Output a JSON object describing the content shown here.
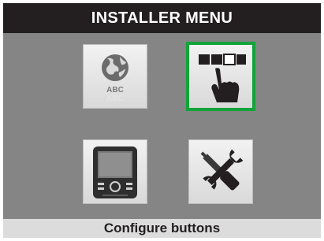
{
  "header": {
    "title": "INSTALLER MENU"
  },
  "footer": {
    "status_text": "Configure buttons"
  },
  "menu": {
    "selected": "configure-buttons",
    "items": [
      {
        "id": "language",
        "icon": "globe-abc-icon",
        "icon_text": "ABC"
      },
      {
        "id": "configure-buttons",
        "icon": "hand-press-button-icon"
      },
      {
        "id": "display",
        "icon": "thermostat-display-icon"
      },
      {
        "id": "tools",
        "icon": "wrench-screwdriver-icon"
      }
    ]
  },
  "colors": {
    "header_bg": "#231f20",
    "body_bg": "#858585",
    "footer_bg": "#dcdcdc",
    "selection": "#12a33a"
  }
}
